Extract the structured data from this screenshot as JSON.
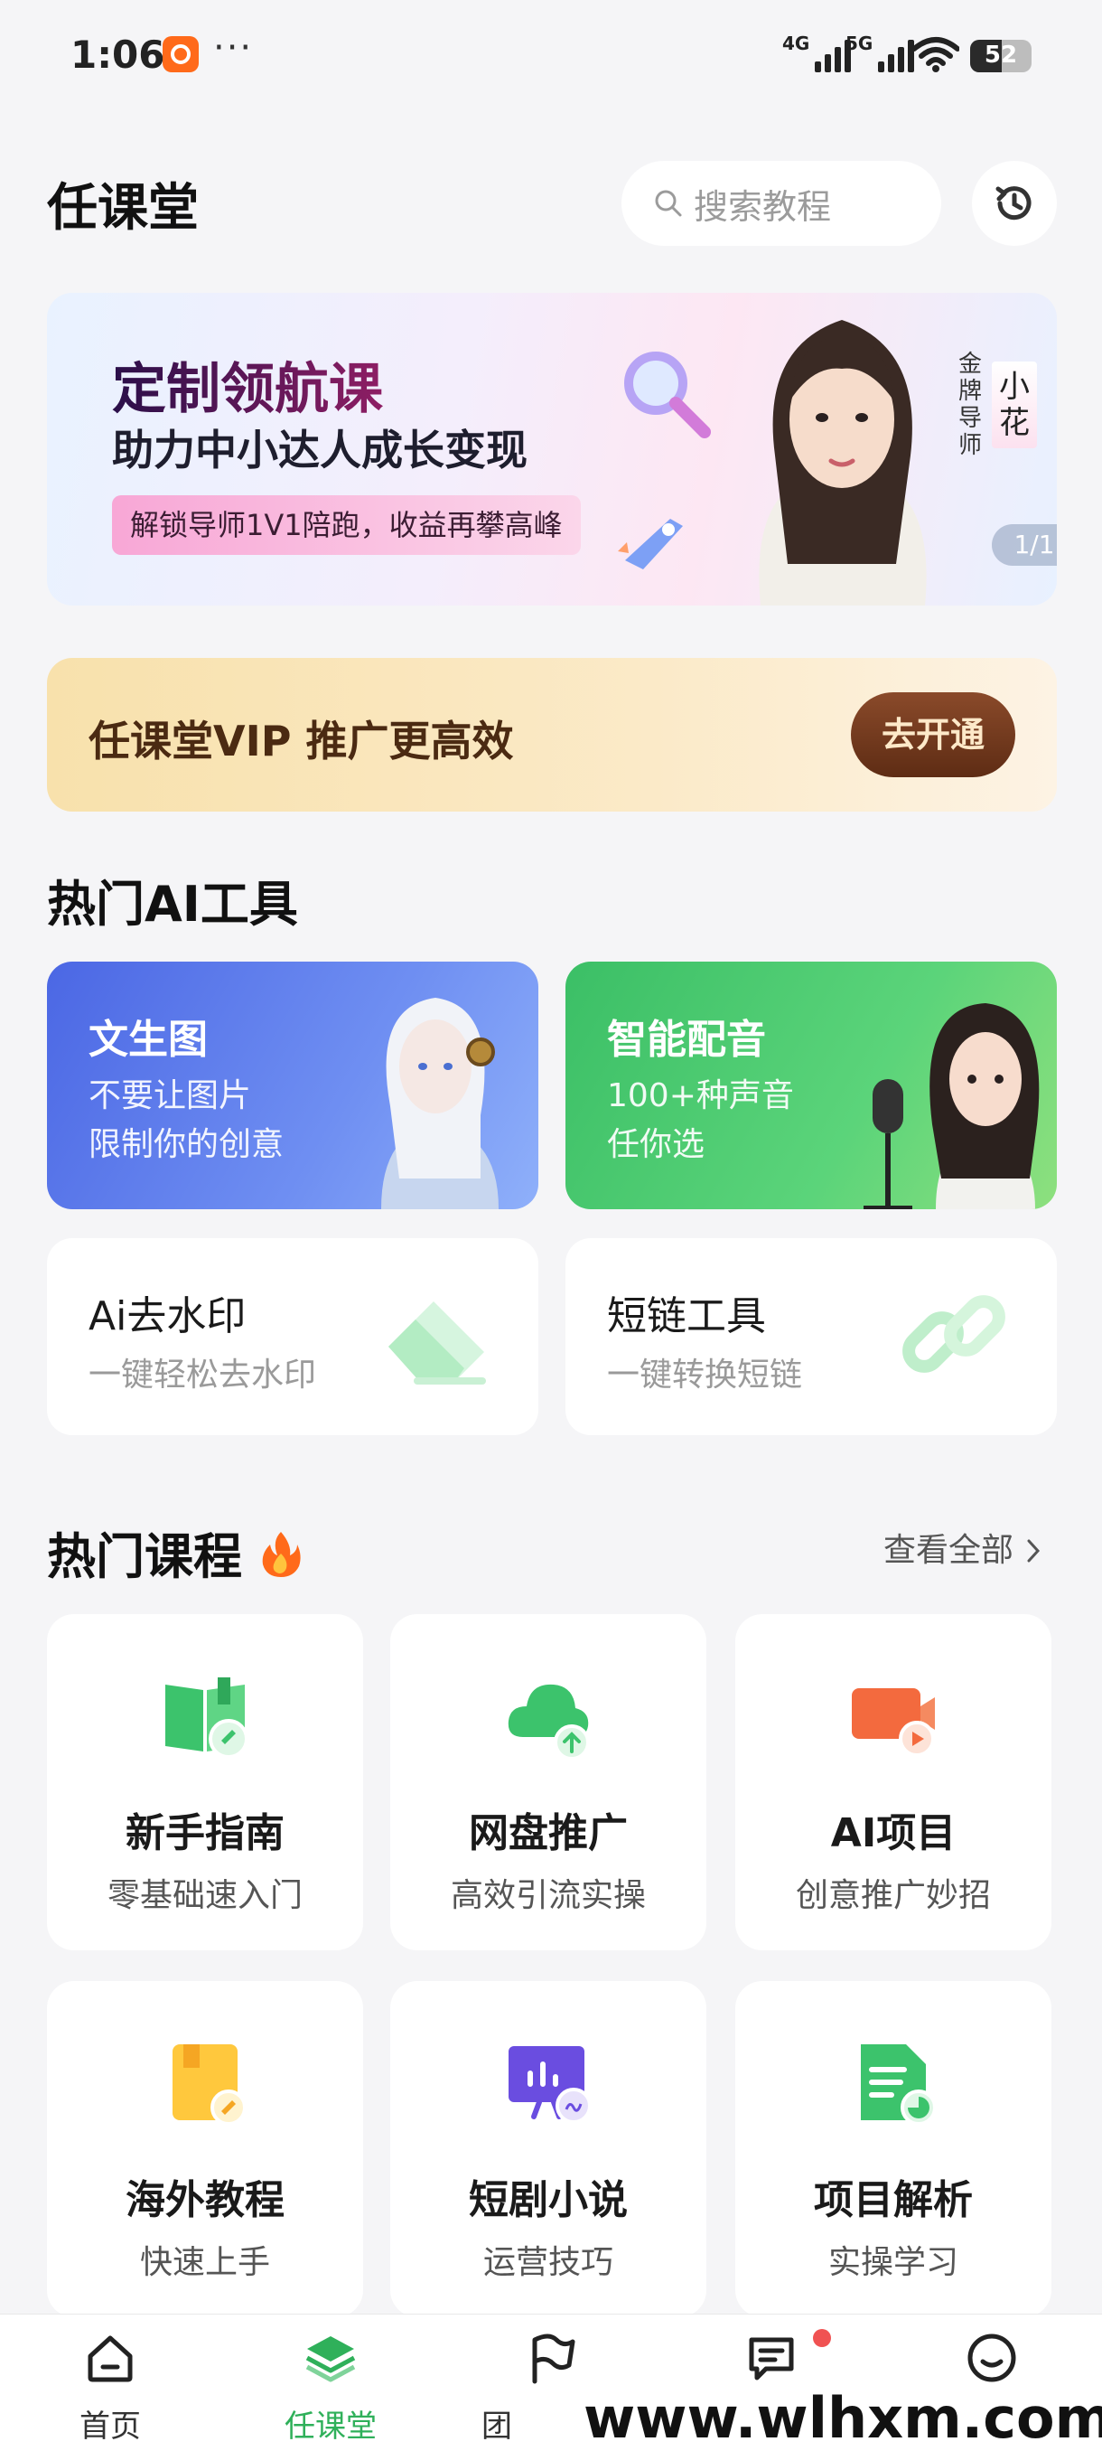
{
  "status_bar": {
    "time": "1:06",
    "more": "···",
    "network1": "4G",
    "network2": "5G",
    "battery": "52"
  },
  "header": {
    "title": "任课堂",
    "search_placeholder": "搜索教程"
  },
  "banner": {
    "title": "定制领航课",
    "subtitle": "助力中小达人成长变现",
    "pill": "解锁导师1V1陪跑，收益再攀高峰",
    "tag_role": "金牌导师",
    "tag_name": "小花",
    "page_indicator": "1/1"
  },
  "vip": {
    "text": "任课堂VIP 推广更高效",
    "button": "去开通"
  },
  "ai_tools": {
    "title": "热门AI工具",
    "items": [
      {
        "title": "文生图",
        "desc1": "不要让图片",
        "desc2": "限制你的创意"
      },
      {
        "title": "智能配音",
        "desc1": "100+种声音",
        "desc2": "任你选"
      },
      {
        "title": "Ai去水印",
        "desc": "一键轻松去水印"
      },
      {
        "title": "短链工具",
        "desc": "一键转换短链"
      }
    ]
  },
  "courses": {
    "title": "热门课程",
    "view_all": "查看全部",
    "items": [
      {
        "title": "新手指南",
        "desc": "零基础速入门"
      },
      {
        "title": "网盘推广",
        "desc": "高效引流实操"
      },
      {
        "title": "AI项目",
        "desc": "创意推广妙招"
      },
      {
        "title": "海外教程",
        "desc": "快速上手"
      },
      {
        "title": "短剧小说",
        "desc": "运营技巧"
      },
      {
        "title": "项目解析",
        "desc": "实操学习"
      }
    ]
  },
  "bottom_nav": {
    "items": [
      {
        "label": "首页"
      },
      {
        "label": "任课堂"
      },
      {
        "label": "团"
      },
      {
        "label": ""
      },
      {
        "label": ""
      }
    ]
  },
  "watermark": "www.wlhxm.com",
  "colors": {
    "accent": "#2fb05a",
    "vip_button": "#6b3418",
    "ai_blue": "#5a78ea",
    "ai_green": "#4ccb6e"
  }
}
